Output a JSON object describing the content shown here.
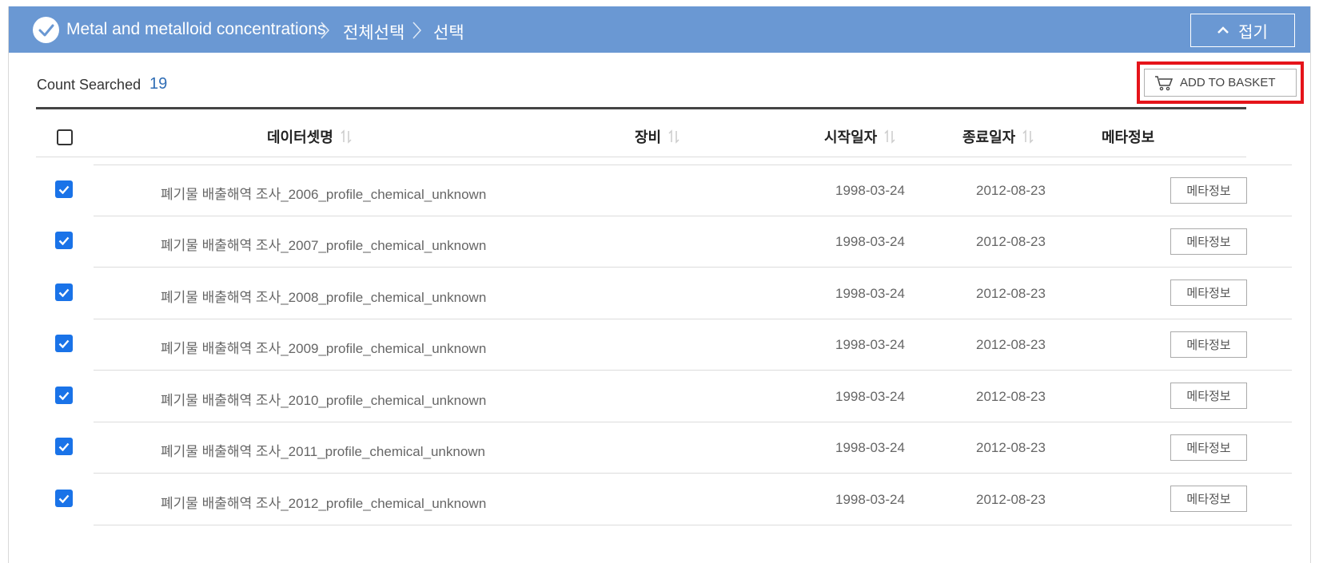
{
  "breadcrumb": {
    "items": [
      "Metal and metalloid concentrations",
      "전체선택",
      "선택"
    ]
  },
  "header": {
    "collapse_label": "접기"
  },
  "summary": {
    "count_label": "Count Searched",
    "count_value": "19"
  },
  "actions": {
    "add_to_basket": "ADD TO BASKET"
  },
  "table": {
    "columns": [
      "데이터셋명",
      "장비",
      "시작일자",
      "종료일자",
      "메타정보"
    ],
    "rows": [
      {
        "name": "폐기물 배출해역 조사_2006_profile_chemical_unknown",
        "equipment": "",
        "start": "1998-03-24",
        "end": "2012-08-23",
        "meta": "메타정보",
        "checked": true
      },
      {
        "name": "폐기물 배출해역 조사_2007_profile_chemical_unknown",
        "equipment": "",
        "start": "1998-03-24",
        "end": "2012-08-23",
        "meta": "메타정보",
        "checked": true
      },
      {
        "name": "폐기물 배출해역 조사_2008_profile_chemical_unknown",
        "equipment": "",
        "start": "1998-03-24",
        "end": "2012-08-23",
        "meta": "메타정보",
        "checked": true
      },
      {
        "name": "폐기물 배출해역 조사_2009_profile_chemical_unknown",
        "equipment": "",
        "start": "1998-03-24",
        "end": "2012-08-23",
        "meta": "메타정보",
        "checked": true
      },
      {
        "name": "폐기물 배출해역 조사_2010_profile_chemical_unknown",
        "equipment": "",
        "start": "1998-03-24",
        "end": "2012-08-23",
        "meta": "메타정보",
        "checked": true
      },
      {
        "name": "폐기물 배출해역 조사_2011_profile_chemical_unknown",
        "equipment": "",
        "start": "1998-03-24",
        "end": "2012-08-23",
        "meta": "메타정보",
        "checked": true
      },
      {
        "name": "폐기물 배출해역 조사_2012_profile_chemical_unknown",
        "equipment": "",
        "start": "1998-03-24",
        "end": "2012-08-23",
        "meta": "메타정보",
        "checked": true
      }
    ]
  },
  "colors": {
    "header_bg": "#6a98d3",
    "link_blue": "#2f6db5",
    "checkbox_blue": "#1a73e8",
    "highlight_red": "#e5141a"
  }
}
